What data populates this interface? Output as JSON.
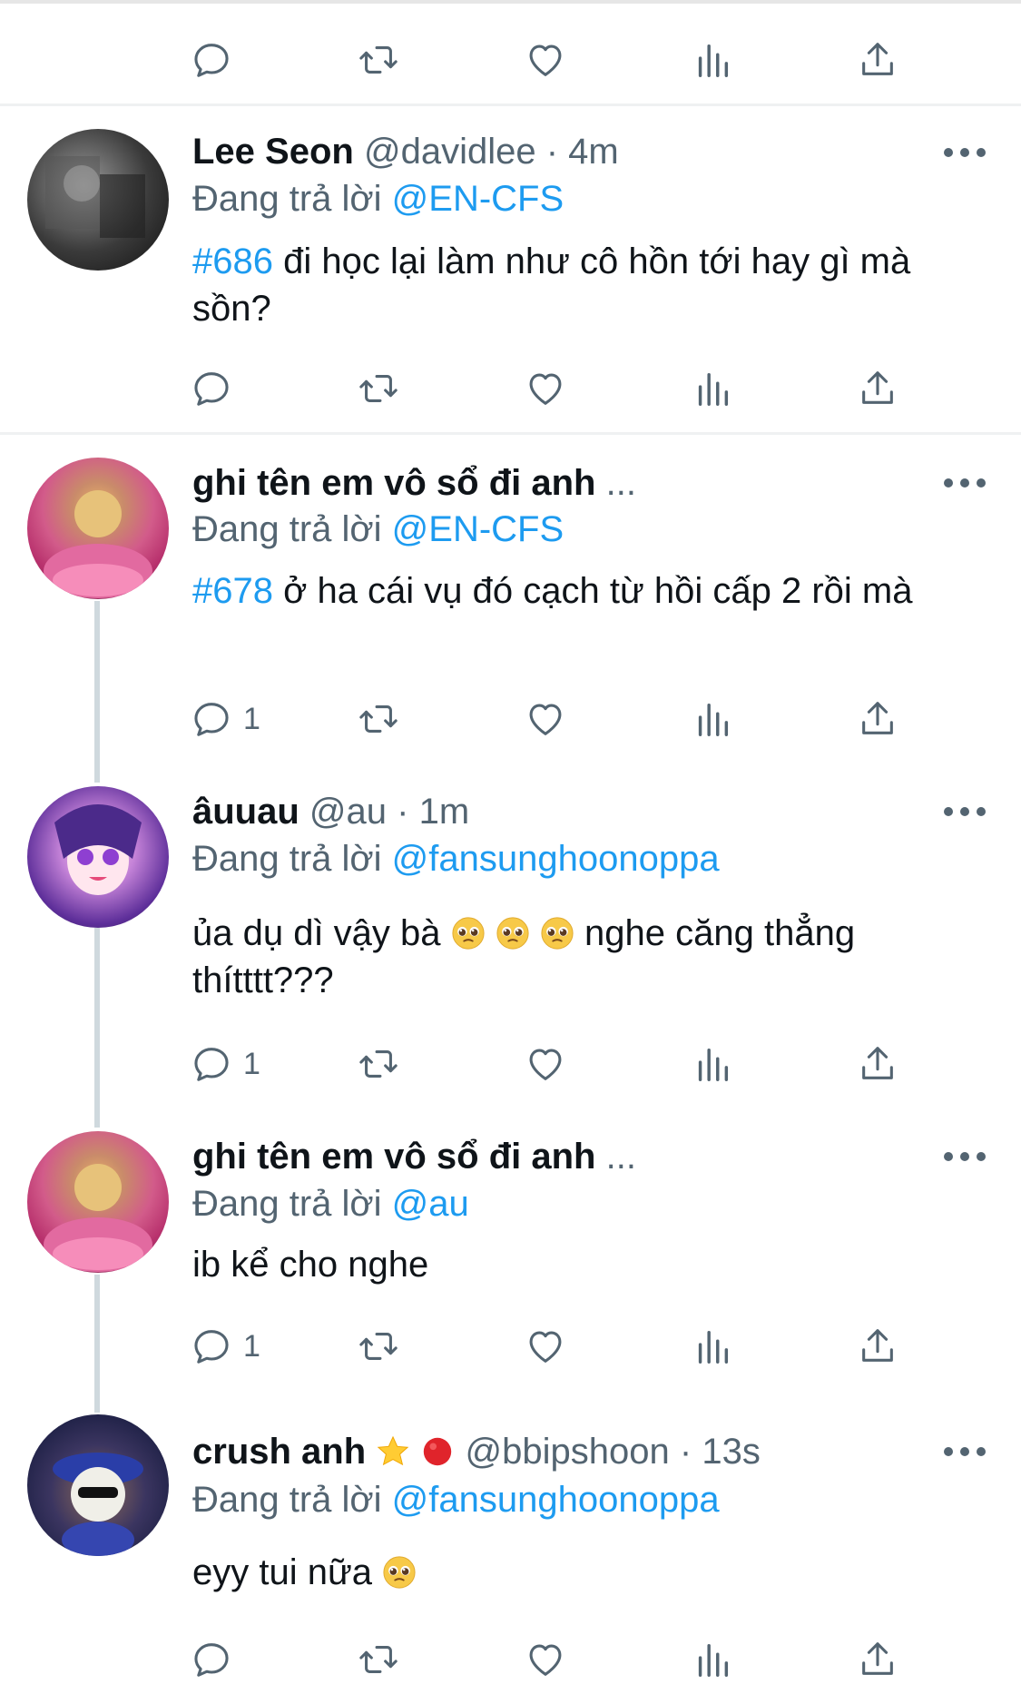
{
  "colors": {
    "link": "#1d9bf0",
    "text": "#0f1419",
    "secondary": "#536471",
    "icon": "#536471"
  },
  "tweets": [
    {
      "name": "Lee Seon",
      "handle": "@davidlee",
      "time": "4m",
      "reply_prefix": "Đang trả lời",
      "reply_to": "@EN-CFS",
      "hashtag": "#686",
      "text": " đi học lại làm như cô hồn tới hay gì mà sồn?",
      "reply_count": ""
    },
    {
      "name": "ghi tên em vô sổ đi anh",
      "ellipsis": "...",
      "reply_prefix": "Đang trả lời",
      "reply_to": "@EN-CFS",
      "hashtag": "#678",
      "text": " ở ha cái vụ đó cạch từ hồi cấp 2 rồi mà",
      "reply_count": "1"
    },
    {
      "name": "âuuau",
      "handle": "@au",
      "time": "1m",
      "reply_prefix": "Đang trả lời",
      "reply_to": "@fansunghoonoppa",
      "text_a": "ủa dụ dì vậy bà",
      "text_b": "nghe căng thẳng thítttt???",
      "reply_count": "1"
    },
    {
      "name": "ghi tên em vô sổ đi anh",
      "ellipsis": "...",
      "reply_prefix": "Đang trả lời",
      "reply_to": "@au",
      "text": "ib kể cho nghe",
      "reply_count": "1"
    },
    {
      "name": "crush anh",
      "handle": "@bbipshoon",
      "time": "13s",
      "reply_prefix": "Đang trả lời",
      "reply_to": "@fansunghoonoppa",
      "text": "eyy tui nữa",
      "reply_count": ""
    }
  ],
  "icons": [
    "reply-icon",
    "retweet-icon",
    "like-icon",
    "analytics-icon",
    "share-icon",
    "more-icon",
    "pleading-face-emoji",
    "star-emoji",
    "red-circle-emoji"
  ]
}
